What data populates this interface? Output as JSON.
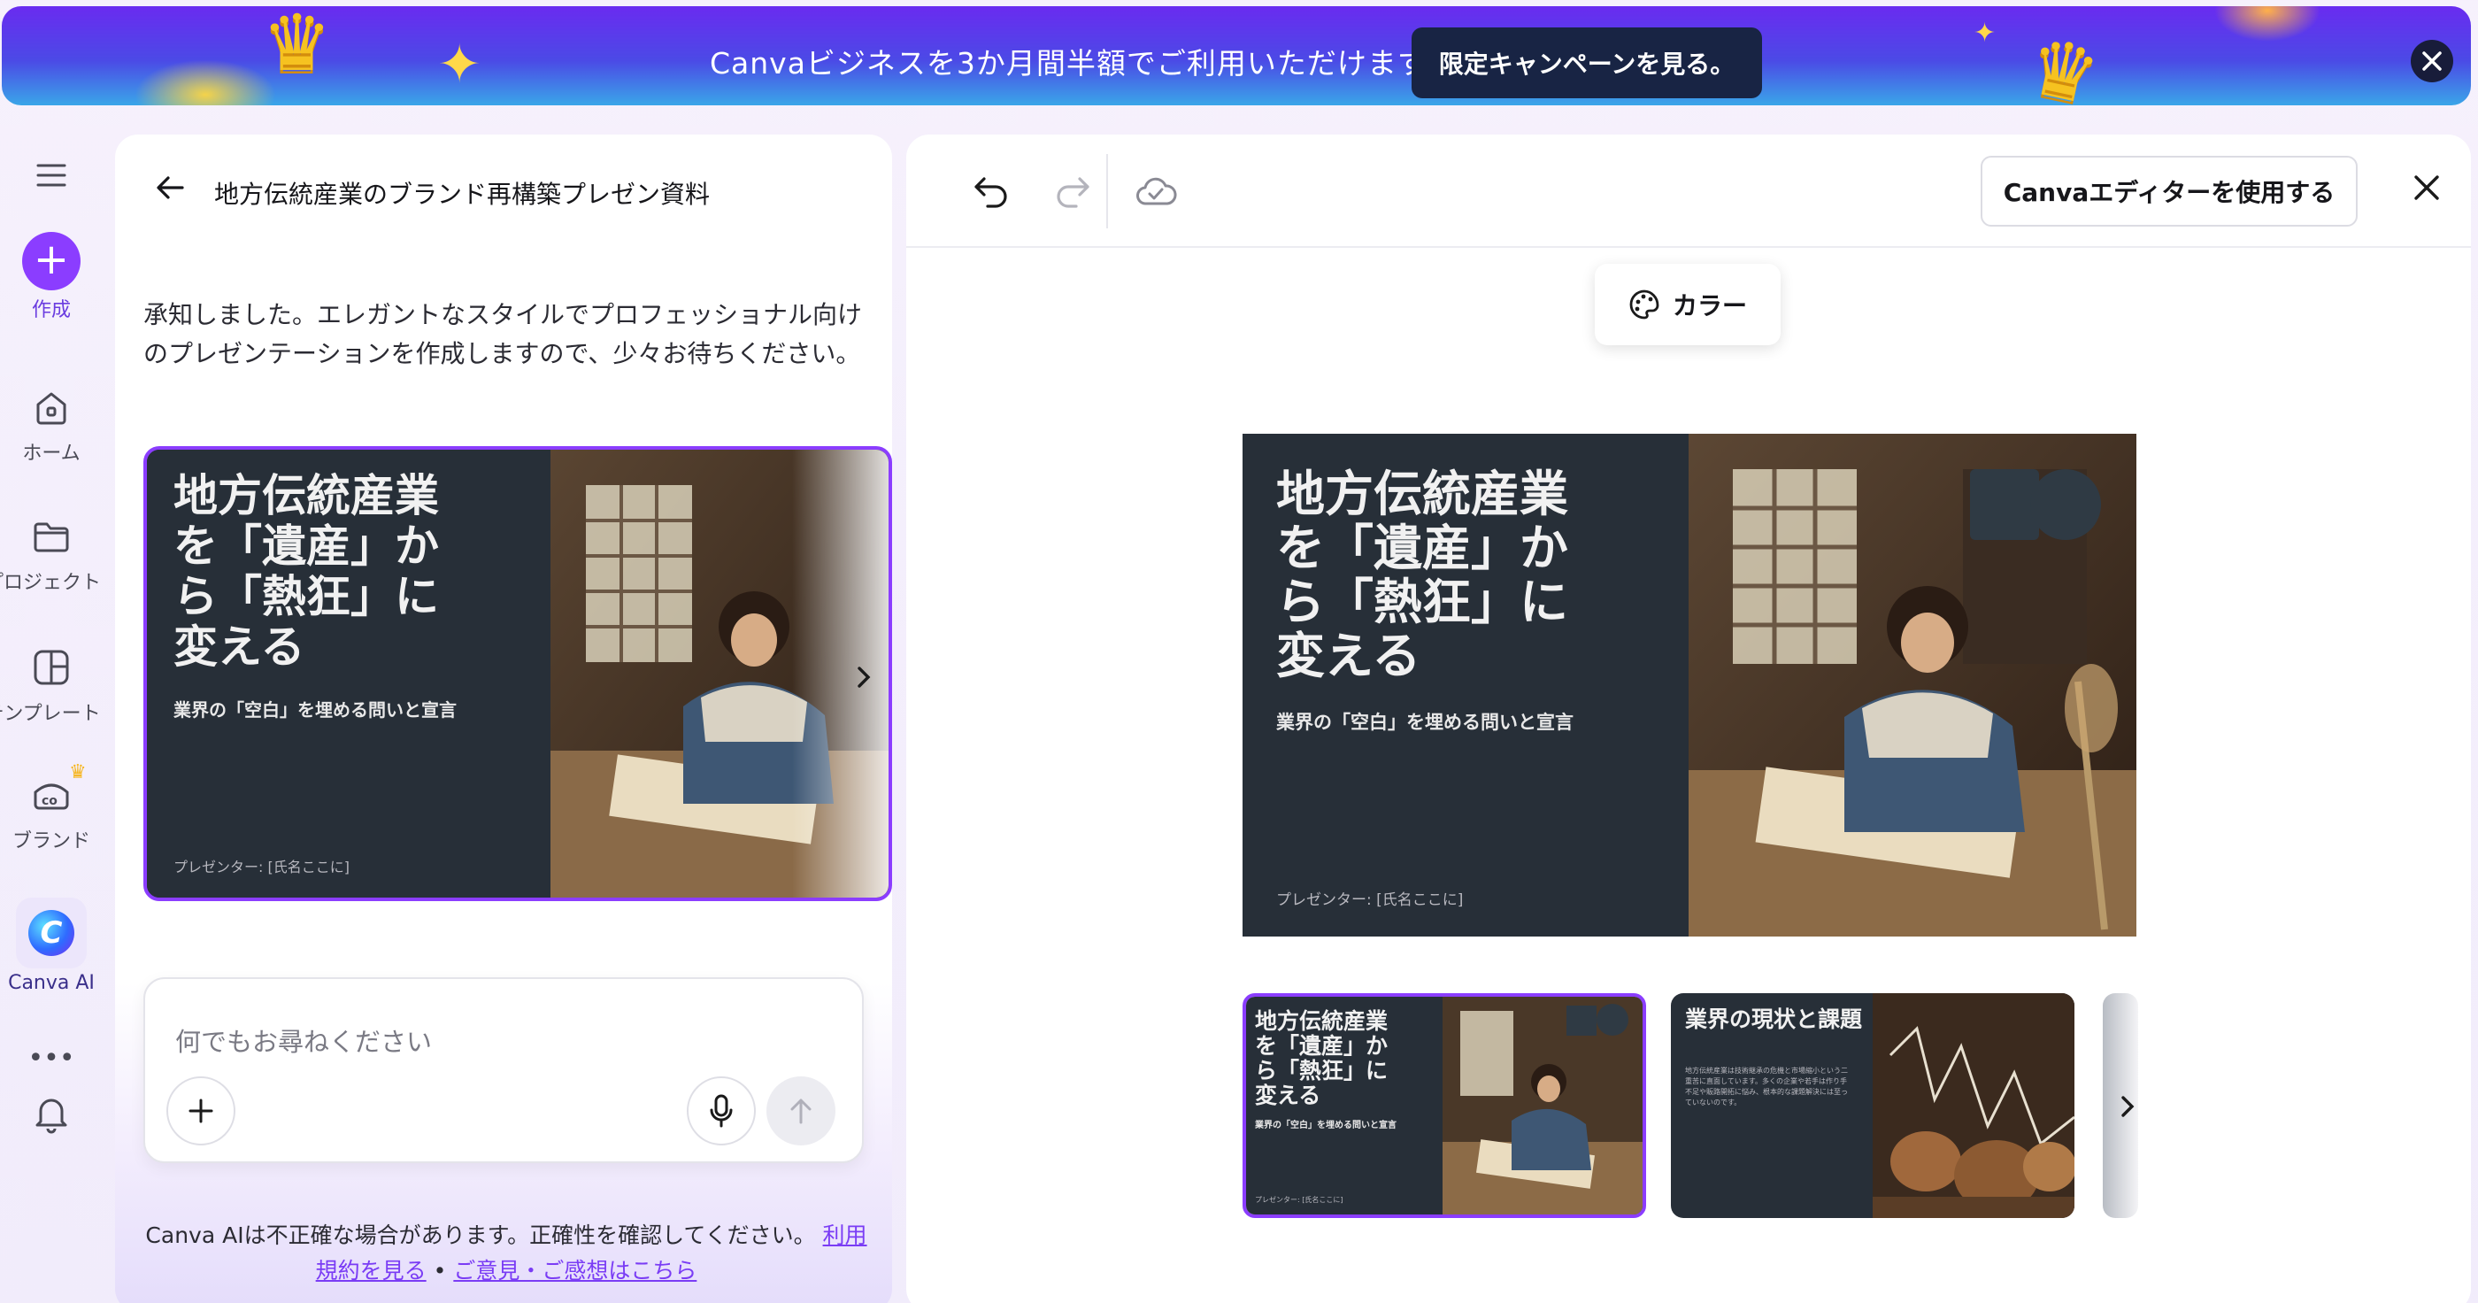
{
  "banner": {
    "text": "Canvaビジネスを3か月間半額でご利用いただけます。",
    "cta": "限定キャンペーンを見る。",
    "accent": "#6a2bf0"
  },
  "rail": {
    "items": [
      {
        "label": "作成",
        "icon": "plus-icon"
      },
      {
        "label": "ホーム",
        "icon": "home-icon"
      },
      {
        "label": "プロジェクト",
        "icon": "folder-icon"
      },
      {
        "label": "テンプレート",
        "icon": "template-icon"
      },
      {
        "label": "ブランド",
        "icon": "brand-icon"
      },
      {
        "label": "Canva AI",
        "icon": "canva-ai-icon"
      }
    ]
  },
  "chat": {
    "title": "地方伝統産業のブランド再構築プレゼン資料",
    "message": "承知しました。エレガントなスタイルでプロフェッショナル向けのプレゼンテーションを作成しますので、少々お待ちください。",
    "input_placeholder": "何でもお尋ねください",
    "disclaimer_text": "Canva AIは不正確な場合があります。正確性を確認してください。",
    "disclaimer_link1": "利用規約を見る",
    "disclaimer_sep": "•",
    "disclaimer_link2": "ご意見・ご感想はこちら"
  },
  "slide": {
    "title": "地方伝統産業を「遺産」から「熱狂」に変える",
    "subtitle": "業界の「空白」を埋める問いと宣言",
    "presenter": "プレゼンター: [氏名ここに]"
  },
  "slide2": {
    "title": "業界の現状と課題",
    "body": "地方伝統産業は技術継承の危機と市場縮小という二重苦に直面しています。多くの企業や若手は作り手不足や販路開拓に悩み、根本的な課題解決には至っていないのです。"
  },
  "editor": {
    "cta": "Canvaエディターを使用する",
    "color_chip": "カラー",
    "accent": "#8b3dff"
  }
}
